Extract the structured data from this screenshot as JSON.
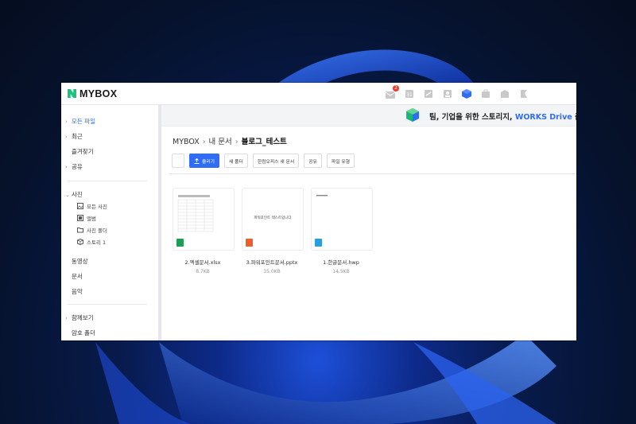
{
  "colors": {
    "accent": "#2f6df6",
    "logo_green": "#19c37d",
    "excel": "#1f9d55",
    "ppt": "#e8602c",
    "hwp": "#2d9cdb"
  },
  "app": {
    "logo_text": "MYBOX"
  },
  "top_icons": [
    {
      "icon": "mail-icon",
      "badge": "2"
    },
    {
      "icon": "calendar-icon"
    },
    {
      "icon": "board-icon"
    },
    {
      "icon": "contacts-icon"
    },
    {
      "icon": "mybox-cube-icon"
    },
    {
      "icon": "work-icon"
    },
    {
      "icon": "notes-icon"
    },
    {
      "icon": "bookmark-icon"
    }
  ],
  "sidebar": {
    "items": [
      {
        "label": "모든 파일",
        "active": true
      },
      {
        "label": "최근"
      },
      {
        "label": "즐겨찾기"
      },
      {
        "label": "공유"
      },
      {
        "label": "사진"
      }
    ],
    "photo_sub": [
      {
        "label": "모든 사진",
        "icon": "image-icon"
      },
      {
        "label": "앨범",
        "icon": "album-icon"
      },
      {
        "label": "사진 폴더",
        "icon": "photo-folder-icon"
      },
      {
        "label": "스토리 1",
        "icon": "cube-icon"
      }
    ],
    "items2": [
      {
        "label": "동영상"
      },
      {
        "label": "문서"
      },
      {
        "label": "음악"
      }
    ],
    "items3": [
      {
        "label": "함께보기"
      },
      {
        "label": "암호 폴더"
      }
    ]
  },
  "banner": {
    "text_before": "팀, 기업을 위한 스토리지, ",
    "highlight": "WORKS Drive",
    "text_after": " 출시"
  },
  "breadcrumb": {
    "root": "MYBOX",
    "mid": "내 문서",
    "current": "블로그_테스트"
  },
  "toolbar": {
    "upload": "올리기",
    "new_folder": "새 폴더",
    "new_doc": "한컴오피스 새 문서",
    "share": "공유",
    "change_type": "파일 유형"
  },
  "files": [
    {
      "name": "2.엑셀문서.xlsx",
      "size": "8.7KB",
      "type": "xlsx"
    },
    {
      "name": "3.파워포인트문서.pptx",
      "size": "35.0KB",
      "type": "pptx",
      "preview_text": "파워포인트 테스트입니다"
    },
    {
      "name": "1.한글문서.hwp",
      "size": "14.5KB",
      "type": "hwp"
    }
  ]
}
